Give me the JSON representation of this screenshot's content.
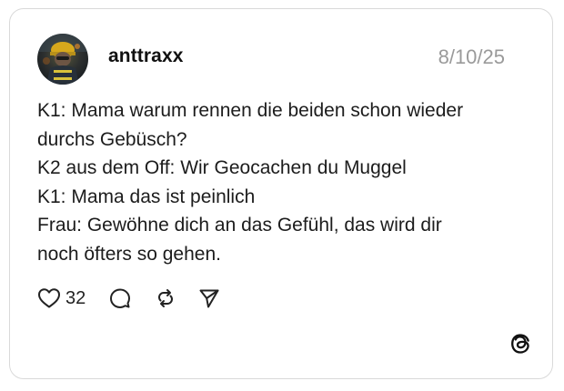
{
  "post": {
    "username": "anttraxx",
    "date": "8/10/25",
    "lines": [
      "K1: Mama warum rennen die beiden schon wieder",
      "durchs Gebüsch?",
      "K2 aus dem Off: Wir Geocachen du Muggel",
      "K1: Mama das ist peinlich",
      "Frau: Gewöhne dich an das Gefühl, das wird dir",
      "noch öfters so gehen."
    ],
    "like_count": "32"
  },
  "icons": {
    "like": "heart-icon",
    "reply": "speech-bubble-icon",
    "repost": "repost-icon",
    "share": "send-icon",
    "brand": "threads-logo-icon",
    "avatar": "avatar-image"
  },
  "colors": {
    "border": "#d9d9d9",
    "text": "#1c1c1c",
    "muted": "#9a9a9a",
    "icon": "#222222"
  }
}
